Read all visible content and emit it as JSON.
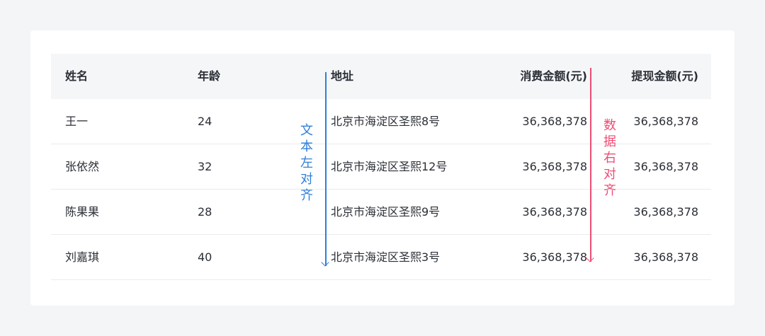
{
  "table": {
    "headers": {
      "name": "姓名",
      "age": "年龄",
      "address": "地址",
      "spend": "消费金额(元)",
      "withdraw": "提现金额(元)"
    },
    "rows": [
      {
        "name": "王一",
        "age": "24",
        "address": "北京市海淀区圣熙8号",
        "spend": "36,368,378",
        "withdraw": "36,368,378"
      },
      {
        "name": "张依然",
        "age": "32",
        "address": "北京市海淀区圣熙12号",
        "spend": "36,368,378",
        "withdraw": "36,368,378"
      },
      {
        "name": "陈果果",
        "age": "28",
        "address": "北京市海淀区圣熙9号",
        "spend": "36,368,378",
        "withdraw": "36,368,378"
      },
      {
        "name": "刘嘉琪",
        "age": "40",
        "address": "北京市海淀区圣熙3号",
        "spend": "36,368,378",
        "withdraw": "36,368,378"
      }
    ]
  },
  "annotations": {
    "left_align_label": "文本左对齐",
    "right_align_label": "数据右对齐",
    "left_color": "#2f7fd8",
    "right_color": "#ee4d74"
  }
}
